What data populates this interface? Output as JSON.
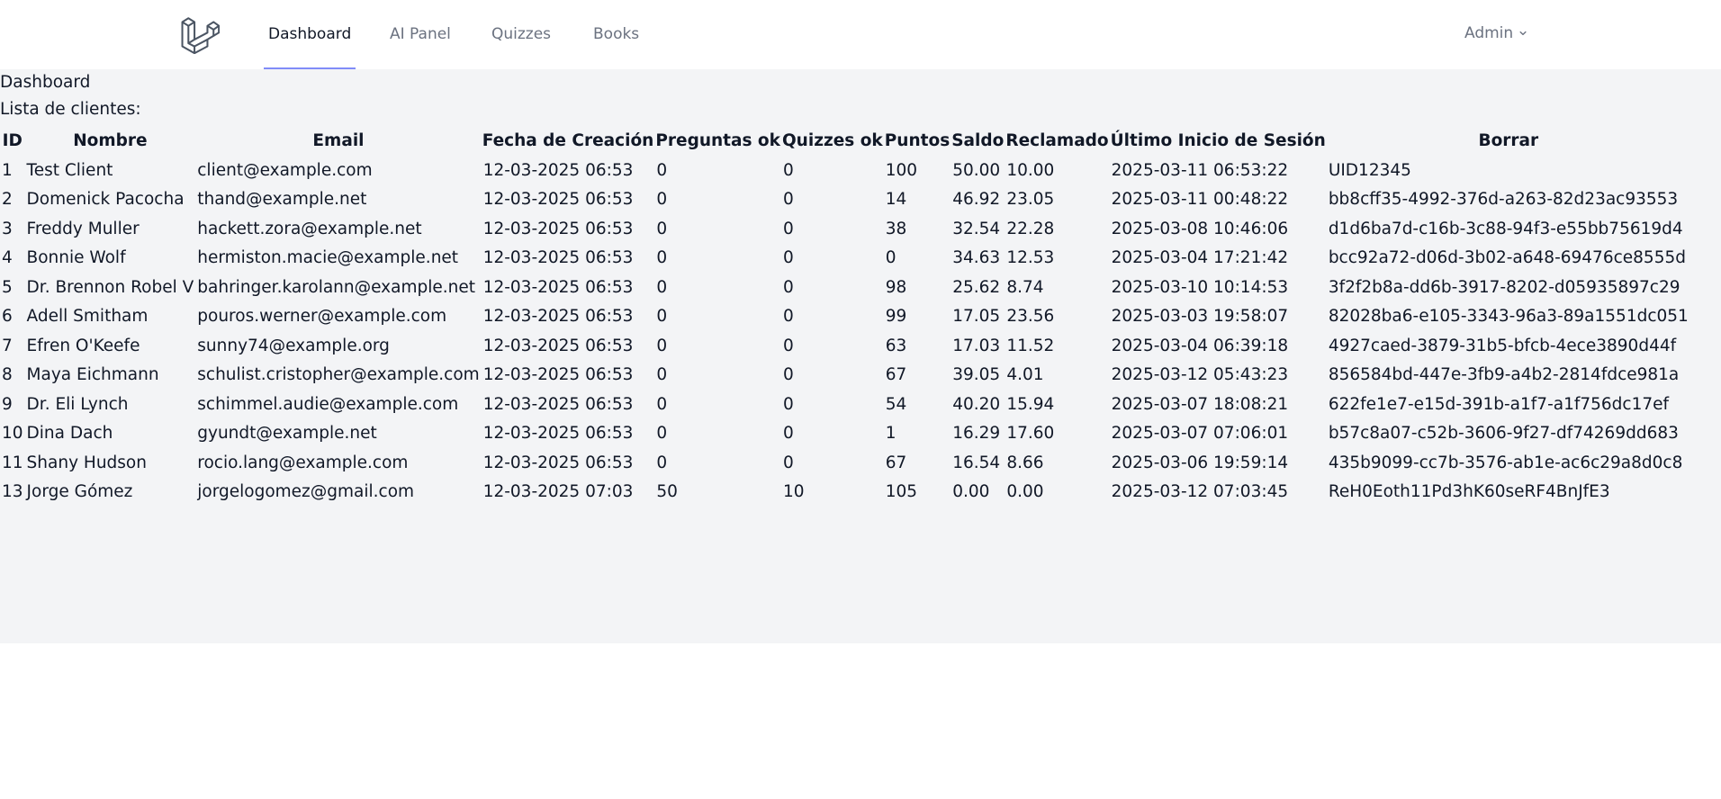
{
  "nav": {
    "links": [
      "Dashboard",
      "AI Panel",
      "Quizzes",
      "Books"
    ],
    "active": "Dashboard",
    "user": "Admin"
  },
  "main": {
    "heading": "Dashboard",
    "subheading": "Lista de clientes:"
  },
  "table": {
    "headers": [
      "ID",
      "Nombre",
      "Email",
      "Fecha de Creación",
      "Preguntas ok",
      "Quizzes ok",
      "Puntos",
      "Saldo",
      "Reclamado",
      "Último Inicio de Sesión",
      "Borrar"
    ],
    "rows": [
      [
        "1",
        "Test Client",
        "client@example.com",
        "12-03-2025 06:53",
        "0",
        "0",
        "100",
        "50.00",
        "10.00",
        "2025-03-11 06:53:22",
        "UID12345"
      ],
      [
        "2",
        "Domenick Pacocha",
        "thand@example.net",
        "12-03-2025 06:53",
        "0",
        "0",
        "14",
        "46.92",
        "23.05",
        "2025-03-11 00:48:22",
        "bb8cff35-4992-376d-a263-82d23ac93553"
      ],
      [
        "3",
        "Freddy Muller",
        "hackett.zora@example.net",
        "12-03-2025 06:53",
        "0",
        "0",
        "38",
        "32.54",
        "22.28",
        "2025-03-08 10:46:06",
        "d1d6ba7d-c16b-3c88-94f3-e55bb75619d4"
      ],
      [
        "4",
        "Bonnie Wolf",
        "hermiston.macie@example.net",
        "12-03-2025 06:53",
        "0",
        "0",
        "0",
        "34.63",
        "12.53",
        "2025-03-04 17:21:42",
        "bcc92a72-d06d-3b02-a648-69476ce8555d"
      ],
      [
        "5",
        "Dr. Brennon Robel V",
        "bahringer.karolann@example.net",
        "12-03-2025 06:53",
        "0",
        "0",
        "98",
        "25.62",
        "8.74",
        "2025-03-10 10:14:53",
        "3f2f2b8a-dd6b-3917-8202-d05935897c29"
      ],
      [
        "6",
        "Adell Smitham",
        "pouros.werner@example.com",
        "12-03-2025 06:53",
        "0",
        "0",
        "99",
        "17.05",
        "23.56",
        "2025-03-03 19:58:07",
        "82028ba6-e105-3343-96a3-89a1551dc051"
      ],
      [
        "7",
        "Efren O'Keefe",
        "sunny74@example.org",
        "12-03-2025 06:53",
        "0",
        "0",
        "63",
        "17.03",
        "11.52",
        "2025-03-04 06:39:18",
        "4927caed-3879-31b5-bfcb-4ece3890d44f"
      ],
      [
        "8",
        "Maya Eichmann",
        "schulist.cristopher@example.com",
        "12-03-2025 06:53",
        "0",
        "0",
        "67",
        "39.05",
        "4.01",
        "2025-03-12 05:43:23",
        "856584bd-447e-3fb9-a4b2-2814fdce981a"
      ],
      [
        "9",
        "Dr. Eli Lynch",
        "schimmel.audie@example.com",
        "12-03-2025 06:53",
        "0",
        "0",
        "54",
        "40.20",
        "15.94",
        "2025-03-07 18:08:21",
        "622fe1e7-e15d-391b-a1f7-a1f756dc17ef"
      ],
      [
        "10",
        "Dina Dach",
        "gyundt@example.net",
        "12-03-2025 06:53",
        "0",
        "0",
        "1",
        "16.29",
        "17.60",
        "2025-03-07 07:06:01",
        "b57c8a07-c52b-3606-9f27-df74269dd683"
      ],
      [
        "11",
        "Shany Hudson",
        "rocio.lang@example.com",
        "12-03-2025 06:53",
        "0",
        "0",
        "67",
        "16.54",
        "8.66",
        "2025-03-06 19:59:14",
        "435b9099-cc7b-3576-ab1e-ac6c29a8d0c8"
      ],
      [
        "13",
        "Jorge Gómez",
        "jorgelogomez@gmail.com",
        "12-03-2025 07:03",
        "50",
        "10",
        "105",
        "0.00",
        "0.00",
        "2025-03-12 07:03:45",
        "ReH0Eoth11Pd3hK60seRF4BnJfE3"
      ]
    ]
  },
  "icons": {
    "logo": "laravel-logo-icon",
    "dropdown": "chevron-down-icon"
  },
  "colors": {
    "nav_active_underline": "#818cf8",
    "main_background": "#f3f4f6",
    "nav_text": "#6b7280"
  }
}
